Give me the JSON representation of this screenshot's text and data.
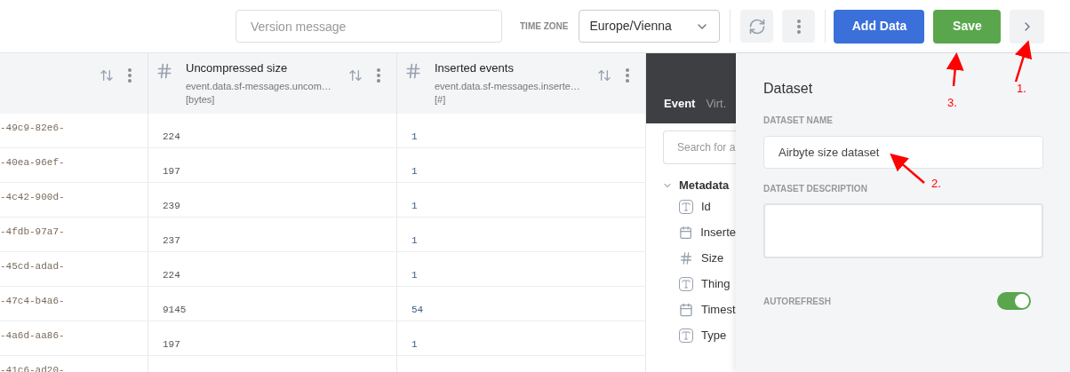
{
  "toolbar": {
    "version_message": {
      "placeholder": "Version message"
    },
    "time_zone": {
      "label": "TIME ZONE",
      "value": "Europe/Vienna"
    },
    "buttons": [
      {
        "label": "Add Data",
        "kind": "primary"
      },
      {
        "label": "Save",
        "kind": "success"
      }
    ]
  },
  "table": {
    "columns": [
      {
        "kind": "plain"
      },
      {
        "kind": "number",
        "title": "Uncompressed size",
        "path": "event.data.sf-messages.uncom…",
        "unit": "[bytes]"
      },
      {
        "kind": "number",
        "title": "Inserted events",
        "path": "event.data.sf-messages.inserte…",
        "unit": "[#]"
      }
    ],
    "rows": [
      [
        "-49c9-82e6-",
        "224",
        "1"
      ],
      [
        "-40ea-96ef-",
        "197",
        "1"
      ],
      [
        "-4c42-900d-",
        "239",
        "1"
      ],
      [
        "-4fdb-97a7-",
        "237",
        "1"
      ],
      [
        "-45cd-adad-",
        "224",
        "1"
      ],
      [
        "-47c4-b4a6-",
        "9145",
        "54"
      ],
      [
        "-4a6d-aa86-",
        "197",
        "1"
      ],
      [
        "-41c6-ad20-"
      ]
    ]
  },
  "explorer": {
    "tabs": [
      {
        "label": "Event",
        "selected": true
      },
      {
        "label": "Virt.",
        "selected": false
      }
    ],
    "search": {
      "placeholder": "Search for a"
    },
    "tree": [
      {
        "label": "Metadata",
        "expanded": true,
        "children": [
          {
            "label": "Id",
            "kind": "text"
          },
          {
            "label": "Inserte",
            "kind": "date"
          },
          {
            "label": "Size",
            "kind": "number"
          },
          {
            "label": "Thing",
            "kind": "text"
          },
          {
            "label": "Timest",
            "kind": "date"
          },
          {
            "label": "Type",
            "kind": "text"
          }
        ]
      }
    ]
  },
  "panel": {
    "title": "Dataset",
    "name_label": "DATASET NAME",
    "name_value": "Airbyte size dataset",
    "description_label": "DATASET DESCRIPTION",
    "autorefresh": {
      "label": "AUTOREFRESH",
      "on": true
    }
  },
  "annotations": [
    {
      "label": "1."
    },
    {
      "label": "2."
    },
    {
      "label": "3."
    }
  ]
}
